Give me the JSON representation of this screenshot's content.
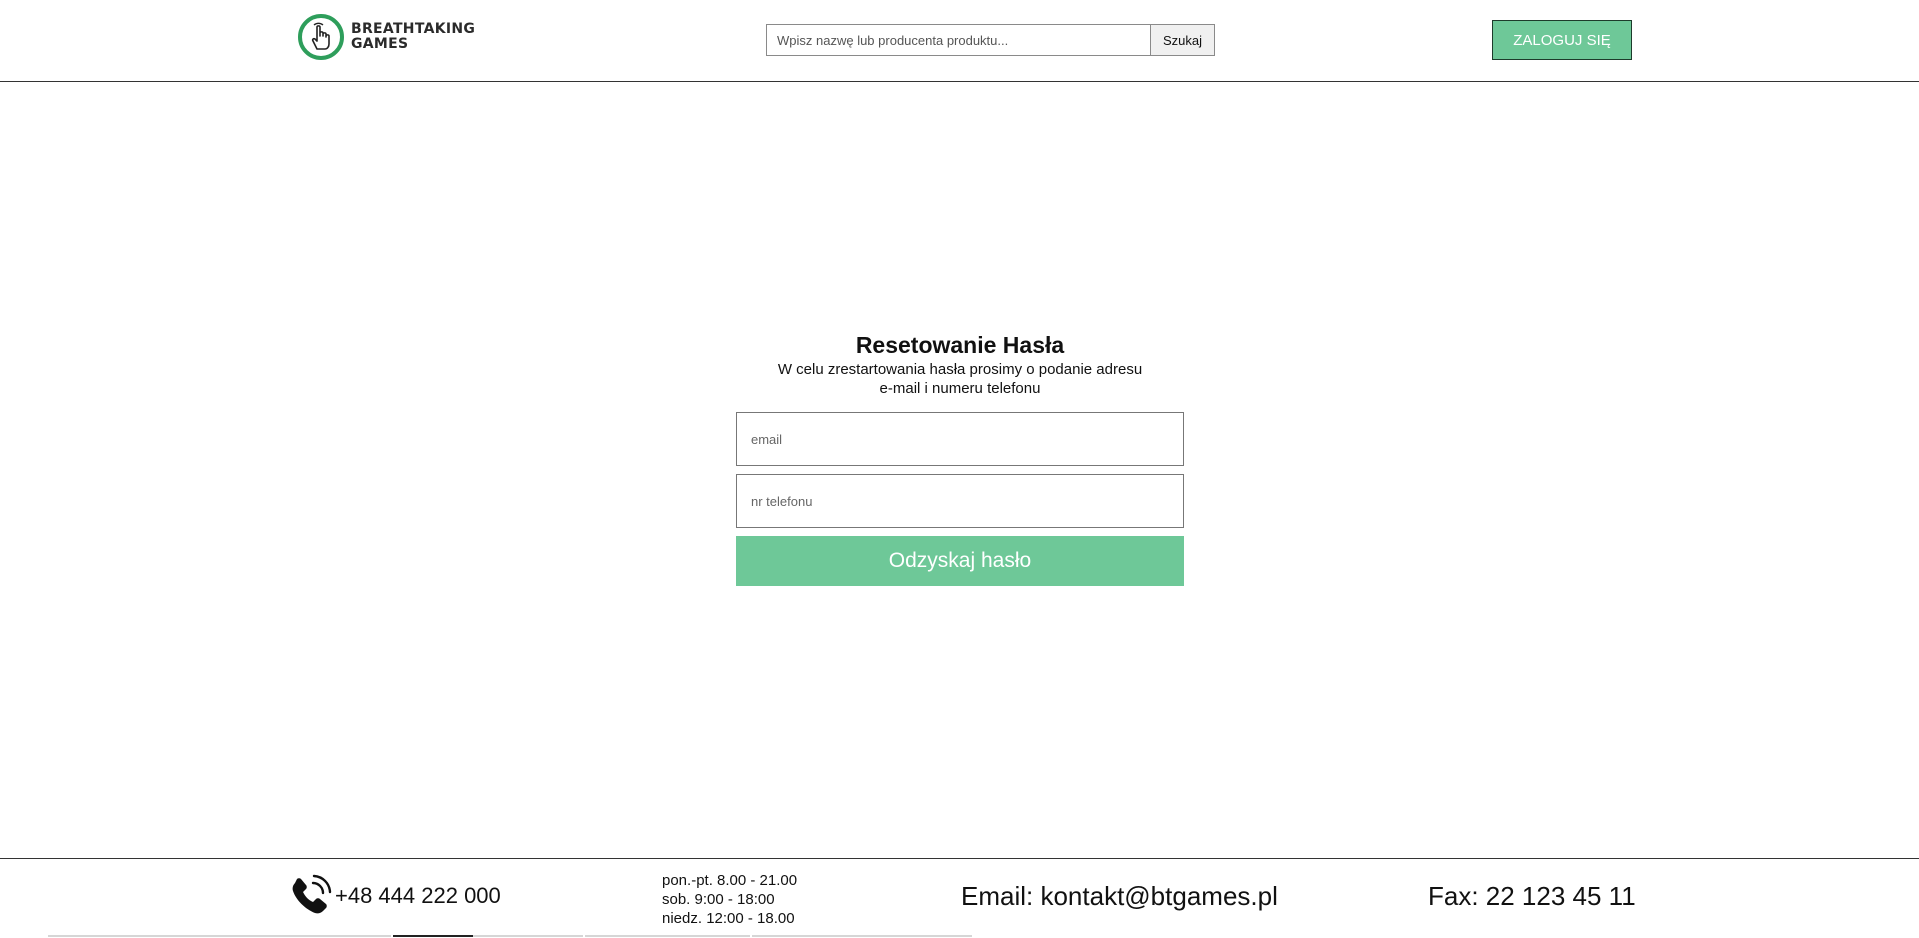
{
  "header": {
    "logo": {
      "line1": "BREATHTAKING",
      "line2": "GAMES",
      "icon": "hand-pointer-icon",
      "accent_color": "#2e9e5b"
    },
    "search": {
      "placeholder": "Wpisz nazwę lub producenta produktu...",
      "value": "",
      "button_label": "Szukaj"
    },
    "login_label": "ZALOGUJ SIĘ"
  },
  "reset": {
    "title": "Resetowanie Hasła",
    "description_line1": "W celu zrestartowania hasła prosimy o podanie adresu",
    "description_line2": "e-mail i numeru telefonu",
    "email_placeholder": "email",
    "phone_placeholder": "nr telefonu",
    "submit_label": "Odzyskaj hasło"
  },
  "footer": {
    "phone_icon": "phone-ringing-icon",
    "phone": "+48 444 222 000",
    "hours": [
      "pon.-pt. 8.00 - 21.00",
      "sob. 9:00 - 18:00",
      "niedz. 12:00 - 18.00"
    ],
    "email": "Email: kontakt@btgames.pl",
    "fax": "Fax: 22 123 45 11"
  },
  "colors": {
    "accent": "#6ec898",
    "logo_ring": "#2e9e5b",
    "text": "#111111",
    "border": "#333333"
  }
}
